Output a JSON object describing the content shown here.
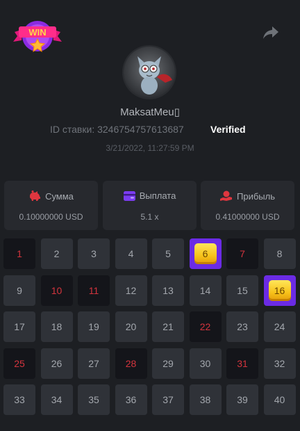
{
  "brand": {
    "logo_text": "WIN"
  },
  "user": {
    "name": "MaksatMeu▯"
  },
  "bet": {
    "id_text": "ID ставки: 3246754757613687",
    "verified": "Verified",
    "timestamp": "3/21/2022, 11:27:59 PM"
  },
  "stats": [
    {
      "icon": "piggy-bank-icon",
      "label": "Сумма",
      "value": "0.10000000 USD"
    },
    {
      "icon": "wallet-icon",
      "label": "Выплата",
      "value": "5.1 x"
    },
    {
      "icon": "coin-hand-icon",
      "label": "Прибыль",
      "value": "0.41000000 USD"
    }
  ],
  "board": {
    "tiles": [
      {
        "n": "1",
        "state": "drawn"
      },
      {
        "n": "2",
        "state": "normal"
      },
      {
        "n": "3",
        "state": "normal"
      },
      {
        "n": "4",
        "state": "normal"
      },
      {
        "n": "5",
        "state": "normal"
      },
      {
        "n": "6",
        "state": "hit"
      },
      {
        "n": "7",
        "state": "drawn"
      },
      {
        "n": "8",
        "state": "normal"
      },
      {
        "n": "9",
        "state": "normal"
      },
      {
        "n": "10",
        "state": "drawn"
      },
      {
        "n": "11",
        "state": "drawn"
      },
      {
        "n": "12",
        "state": "normal"
      },
      {
        "n": "13",
        "state": "normal"
      },
      {
        "n": "14",
        "state": "normal"
      },
      {
        "n": "15",
        "state": "normal"
      },
      {
        "n": "16",
        "state": "hit"
      },
      {
        "n": "17",
        "state": "normal"
      },
      {
        "n": "18",
        "state": "normal"
      },
      {
        "n": "19",
        "state": "normal"
      },
      {
        "n": "20",
        "state": "normal"
      },
      {
        "n": "21",
        "state": "normal"
      },
      {
        "n": "22",
        "state": "drawn"
      },
      {
        "n": "23",
        "state": "normal"
      },
      {
        "n": "24",
        "state": "normal"
      },
      {
        "n": "25",
        "state": "drawn"
      },
      {
        "n": "26",
        "state": "normal"
      },
      {
        "n": "27",
        "state": "normal"
      },
      {
        "n": "28",
        "state": "drawn"
      },
      {
        "n": "29",
        "state": "normal"
      },
      {
        "n": "30",
        "state": "normal"
      },
      {
        "n": "31",
        "state": "drawn"
      },
      {
        "n": "32",
        "state": "normal"
      },
      {
        "n": "33",
        "state": "normal"
      },
      {
        "n": "34",
        "state": "normal"
      },
      {
        "n": "35",
        "state": "normal"
      },
      {
        "n": "36",
        "state": "normal"
      },
      {
        "n": "37",
        "state": "normal"
      },
      {
        "n": "38",
        "state": "normal"
      },
      {
        "n": "39",
        "state": "normal"
      },
      {
        "n": "40",
        "state": "normal"
      }
    ]
  },
  "colors": {
    "background": "#1d1f23",
    "card": "#27292e",
    "tile": "#2f3238",
    "tile_drawn": "#14151a",
    "drawn_number": "#d3343d",
    "hit_border": "#6b2be5",
    "gem": "#f7c21a",
    "accent_purple": "#7b3cf0",
    "accent_red": "#e0363f"
  }
}
